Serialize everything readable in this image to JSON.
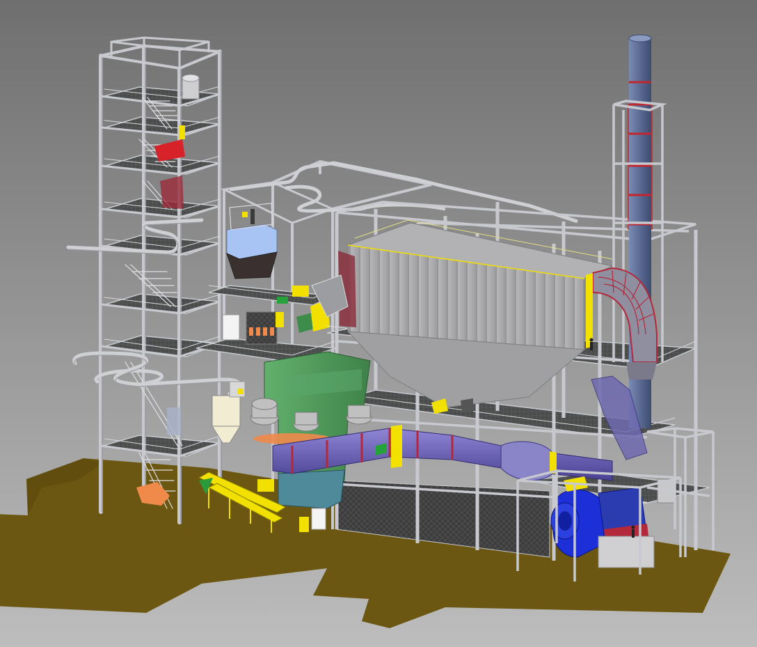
{
  "view": {
    "background_top": "#6f6f6f",
    "background_bottom": "#bdbdbd"
  },
  "colors": {
    "ground": "#6b5712",
    "ground_dark": "#5a480c",
    "steel": "#c7c9cf",
    "steel_dark": "#8e9096",
    "grating": "#4a4b4b",
    "casing": "#a9a9ab",
    "stack": "#5a6a92",
    "stack_ring": "#c0272d",
    "mill": "#4f9a5a",
    "duct": "#6a5fb4",
    "duct_flange": "#b3283a",
    "fan": "#1d2fd6",
    "fan_motor": "#2a3cb0",
    "accent_yellow": "#f2e100",
    "accent_orange": "#f08a4b",
    "accent_red": "#d8222a",
    "filter_blue": "#a8c4f4",
    "hopper_cream": "#f2ecd2",
    "cyclone_grey": "#c0c0c0"
  },
  "components": [
    {
      "id": "feed-tower",
      "icon": "steel-tower-icon"
    },
    {
      "id": "baghouse",
      "icon": "baghouse-icon"
    },
    {
      "id": "stack",
      "icon": "chimney-icon"
    },
    {
      "id": "vertical-mill",
      "icon": "mill-icon"
    },
    {
      "id": "hot-gas-duct",
      "icon": "duct-icon"
    },
    {
      "id": "main-fan",
      "icon": "fan-icon"
    },
    {
      "id": "product-silo",
      "icon": "silo-icon"
    },
    {
      "id": "conveyor",
      "icon": "conveyor-icon"
    }
  ]
}
